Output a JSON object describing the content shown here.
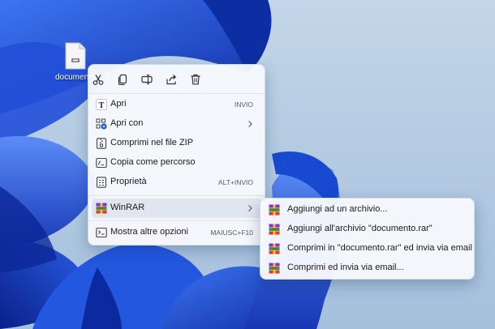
{
  "desktop": {
    "file_label": "documento.rar"
  },
  "context_menu": {
    "quick_actions": [
      {
        "name": "cut-icon"
      },
      {
        "name": "copy-icon"
      },
      {
        "name": "rename-icon"
      },
      {
        "name": "share-icon"
      },
      {
        "name": "delete-icon"
      }
    ],
    "items": [
      {
        "icon": "open-icon",
        "label": "Apri",
        "shortcut": "INVIO"
      },
      {
        "icon": "open-with-icon",
        "label": "Apri con",
        "submenu": true
      },
      {
        "icon": "zip-icon",
        "label": "Comprimi nel file ZIP"
      },
      {
        "icon": "copy-path-icon",
        "label": "Copia come percorso"
      },
      {
        "icon": "properties-icon",
        "label": "Proprietà",
        "shortcut": "ALT+INVIO"
      },
      {
        "icon": "winrar-icon",
        "label": "WinRAR",
        "submenu": true,
        "highlighted": true
      },
      {
        "icon": "more-options-icon",
        "label": "Mostra altre opzioni",
        "shortcut": "MAIUSC+F10"
      }
    ]
  },
  "winrar_submenu": {
    "items": [
      {
        "icon": "winrar-icon",
        "label": "Aggiungi ad un archivio..."
      },
      {
        "icon": "winrar-icon",
        "label": "Aggiungi all'archivio \"documento.rar\""
      },
      {
        "icon": "winrar-icon",
        "label": "Comprimi in \"documento.rar\" ed invia via email"
      },
      {
        "icon": "winrar-icon",
        "label": "Comprimi ed invia via email..."
      }
    ]
  },
  "colors": {
    "accent": "#0a5fd6",
    "menu_bg": "#f6f8fc",
    "highlight": "#e1e6ee",
    "wallpaper_blue": "#1c4fd8"
  }
}
